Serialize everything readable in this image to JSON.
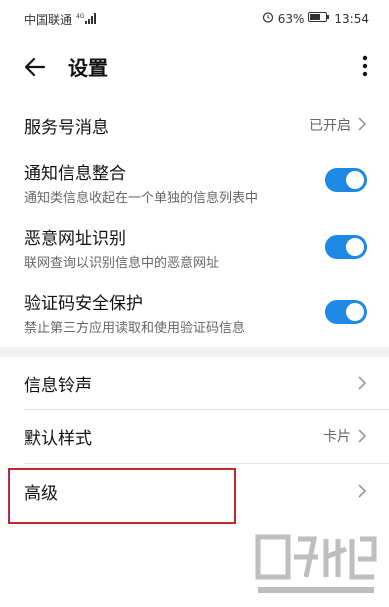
{
  "status_bar": {
    "carrier": "中国联通",
    "network": "4G",
    "battery_percent": "63%",
    "time": "13:54"
  },
  "app_bar": {
    "title": "设置",
    "back_icon": "arrow-left",
    "more_icon": "more-vertical"
  },
  "settings": {
    "service_messages": {
      "label": "服务号消息",
      "value": "已开启"
    },
    "notify_merge": {
      "label": "通知信息整合",
      "description": "通知类信息收起在一个单独的信息列表中",
      "enabled": true
    },
    "malicious_url": {
      "label": "恶意网址识别",
      "description": "联网查询以识别信息中的恶意网址",
      "enabled": true
    },
    "verification_protect": {
      "label": "验证码安全保护",
      "description": "禁止第三方应用读取和使用验证码信息",
      "enabled": true
    },
    "ringtone": {
      "label": "信息铃声"
    },
    "default_style": {
      "label": "默认样式",
      "value": "卡片"
    },
    "advanced": {
      "label": "高级"
    }
  },
  "colors": {
    "toggle_on": "#1e88e5",
    "highlight_border": "#c0282f"
  }
}
